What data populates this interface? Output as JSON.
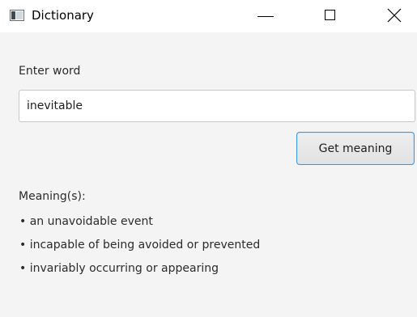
{
  "window": {
    "title": "Dictionary",
    "app_icon": "app-window-icon",
    "controls": {
      "minimize_icon": "minimize-icon",
      "maximize_icon": "maximize-icon",
      "close_icon": "close-icon"
    }
  },
  "form": {
    "label": "Enter word",
    "word_value": "inevitable",
    "button_label": "Get meaning"
  },
  "results": {
    "heading": "Meaning(s):",
    "items": [
      "• an unavoidable event",
      "• incapable of being avoided or prevented",
      "• invariably occurring or appearing"
    ]
  },
  "colors": {
    "background": "#f4f4f4",
    "titlebar": "#ffffff",
    "button_focus_border": "#3a96dd",
    "text": "#2b2b2b"
  }
}
